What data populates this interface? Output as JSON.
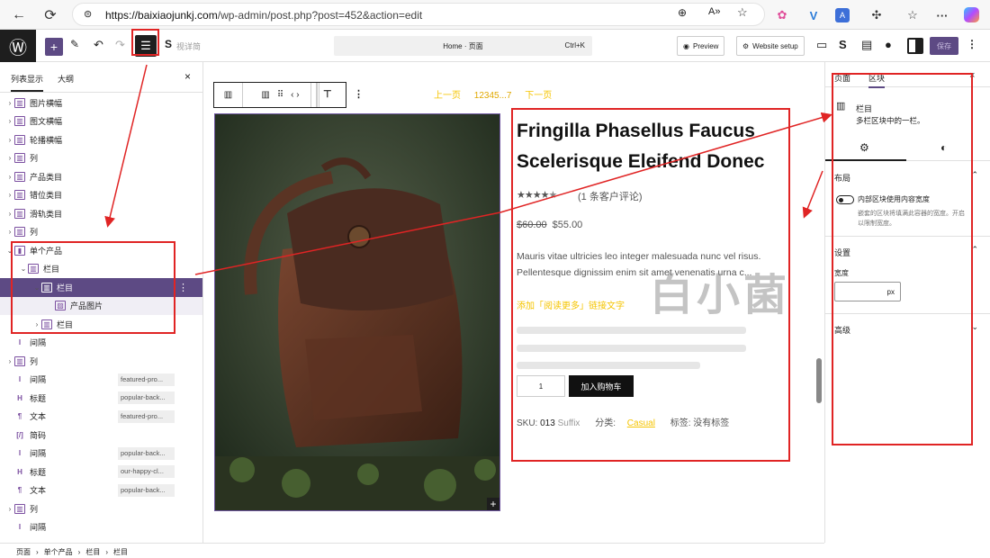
{
  "browser": {
    "url_host": "https://baixiaojunkj.com",
    "url_path": "/wp-admin/post.php?post=452&action=edit",
    "icons": [
      "back-icon",
      "refresh-icon",
      "lock-icon",
      "zoom-icon",
      "read-aloud-icon",
      "favorite-icon",
      "extension-icon",
      "menu-icon",
      "copilot-icon"
    ]
  },
  "toolbar": {
    "command_title": "Home · 页面",
    "command_shortcut": "Ctrl+K",
    "preview_label": "Preview",
    "website_setup_label": "Website setup",
    "save_label": "保存",
    "partial_label": "视详简"
  },
  "left_panel": {
    "tab_list": "列表显示",
    "tab_outline": "大纲",
    "close": "×",
    "items": [
      {
        "label": "图片横幅",
        "icon": "columns-icon",
        "tag": ""
      },
      {
        "label": "图文横幅",
        "icon": "columns-icon",
        "tag": ""
      },
      {
        "label": "轮播横幅",
        "icon": "columns-icon",
        "tag": ""
      },
      {
        "label": "列",
        "icon": "columns-icon",
        "tag": ""
      },
      {
        "label": "产品类目",
        "icon": "columns-icon",
        "tag": ""
      },
      {
        "label": "错位类目",
        "icon": "columns-icon",
        "tag": ""
      },
      {
        "label": "滑轨类目",
        "icon": "columns-icon",
        "tag": ""
      },
      {
        "label": "列",
        "icon": "columns-icon",
        "tag": ""
      },
      {
        "label": "单个产品",
        "icon": "product-icon",
        "tag": ""
      },
      {
        "label": "栏目",
        "icon": "columns-icon",
        "tag": ""
      },
      {
        "label": "栏目",
        "icon": "column-icon",
        "tag": ""
      },
      {
        "label": "产品图片",
        "icon": "image-icon",
        "tag": ""
      },
      {
        "label": "栏目",
        "icon": "column-icon",
        "tag": ""
      },
      {
        "label": "间隔",
        "icon": "spacer-icon",
        "tag": ""
      },
      {
        "label": "列",
        "icon": "columns-icon",
        "tag": ""
      },
      {
        "label": "间隔",
        "icon": "spacer-icon",
        "tag": "featured-pro..."
      },
      {
        "label": "标题",
        "icon": "heading-icon",
        "tag": "popular-back..."
      },
      {
        "label": "文本",
        "icon": "paragraph-icon",
        "tag": "featured-pro..."
      },
      {
        "label": "简码",
        "icon": "shortcode-icon",
        "tag": ""
      },
      {
        "label": "间隔",
        "icon": "spacer-icon",
        "tag": "popular-back..."
      },
      {
        "label": "标题",
        "icon": "heading-icon",
        "tag": "our-happy-cl..."
      },
      {
        "label": "文本",
        "icon": "paragraph-icon",
        "tag": "popular-back..."
      },
      {
        "label": "列",
        "icon": "columns-icon",
        "tag": ""
      },
      {
        "label": "间隔",
        "icon": "spacer-icon",
        "tag": ""
      }
    ]
  },
  "breadcrumb": [
    "页面",
    "›",
    "单个产品",
    "›",
    "栏目",
    "›",
    "栏目"
  ],
  "canvas": {
    "pager": {
      "prev": "上一页",
      "pages": "12345...7",
      "next": "下一页"
    },
    "product": {
      "title": "Fringilla Phasellus Faucus Scelerisque Eleifend Donec",
      "rating": 4,
      "reviews": "(1 条客户评论)",
      "old_price": "$60.00",
      "price": "$55.00",
      "description": "Mauris vitae ultricies leo integer malesuada nunc vel risus. Pellentesque dignissim enim sit amet venenatis urna c...",
      "read_more": "添加「阅读更多」链接文字",
      "qty": "1",
      "add_to_cart": "加入购物车",
      "sku_label": "SKU:",
      "sku": "013",
      "sku_suffix": "Suffix",
      "category_label": "分类:",
      "category": "Casual",
      "tags_label": "标签:",
      "tags": "没有标签"
    },
    "watermark": "白小菌"
  },
  "right_panel": {
    "tab_page": "页面",
    "tab_block": "区块",
    "block_name": "栏目",
    "block_desc": "多栏区块中的一栏。",
    "layout_heading": "布局",
    "toggle_label": "内部区块使用内容宽度",
    "toggle_help_1": "嵌套的区块将填满此容器的宽度。开启",
    "toggle_help_2": "以限制宽度。",
    "settings_heading": "设置",
    "width_label": "宽度",
    "width_unit": "px",
    "advanced_heading": "高级"
  },
  "colors": {
    "accent": "#5d4a84",
    "link": "#f5c400",
    "annotation": "#e02424"
  }
}
